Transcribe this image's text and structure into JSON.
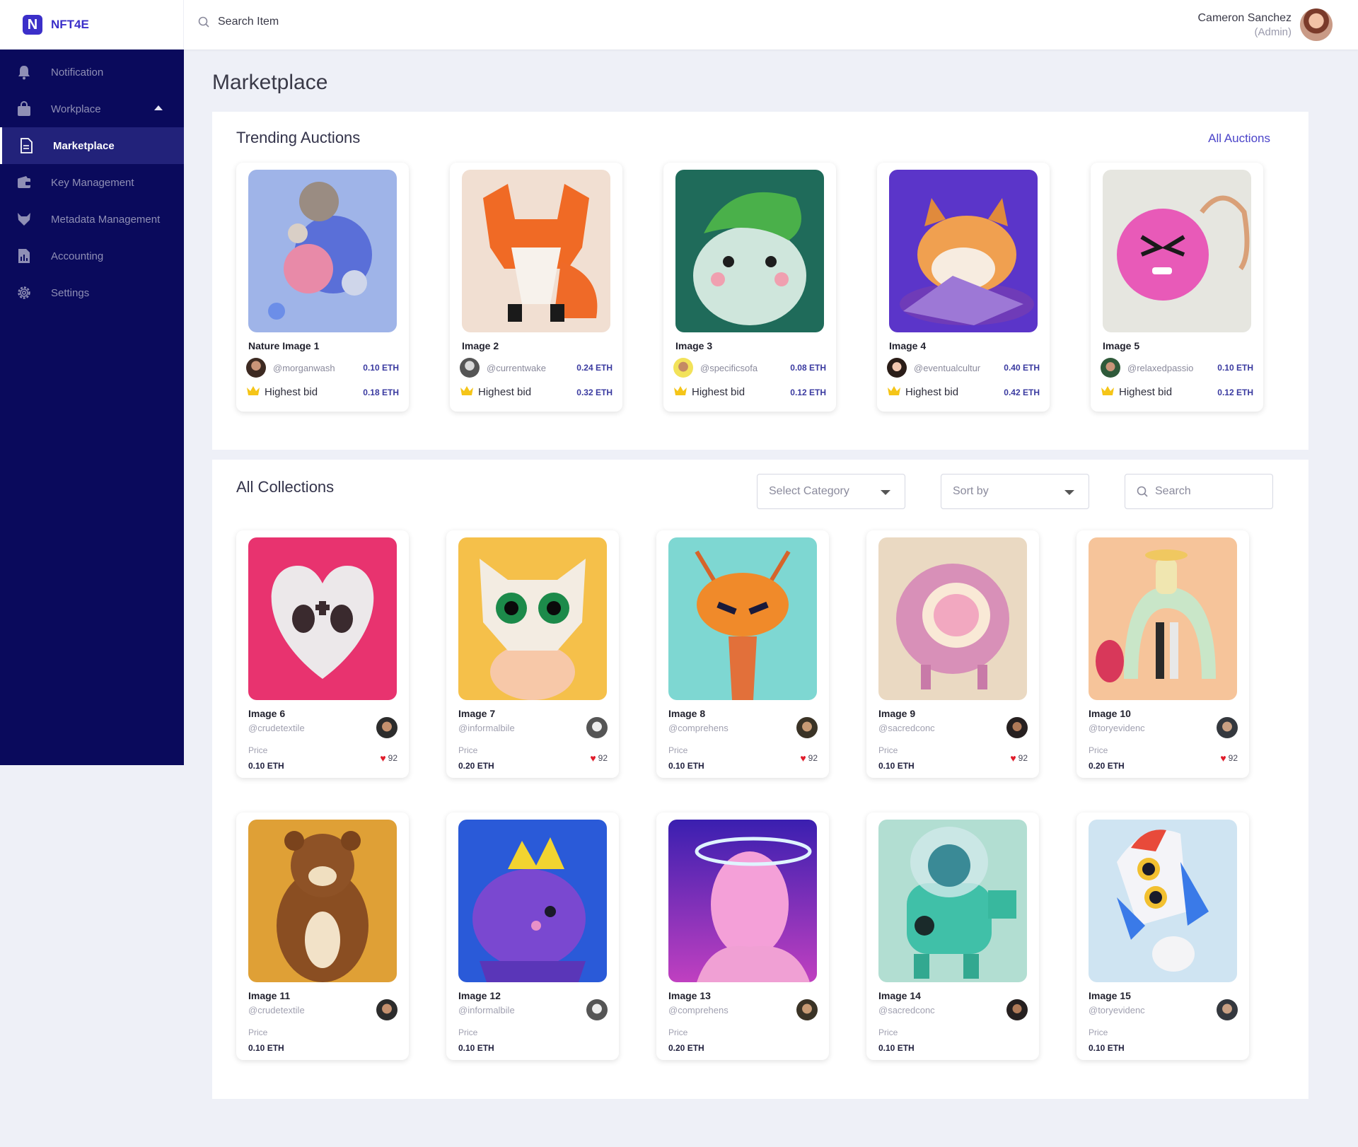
{
  "brand": {
    "logo_letter": "N",
    "name": "NFT4E"
  },
  "top_search": {
    "placeholder": "Search Item"
  },
  "user": {
    "name": "Cameron Sanchez",
    "role": "(Admin)"
  },
  "sidebar": {
    "items": [
      {
        "label": "Notification",
        "icon": "bell-icon"
      },
      {
        "label": "Workplace",
        "icon": "bag-icon"
      },
      {
        "label": "Marketplace",
        "icon": "document-icon",
        "active": true
      },
      {
        "label": "Key Management",
        "icon": "wallet-icon"
      },
      {
        "label": "Metadata Management",
        "icon": "fox-icon"
      },
      {
        "label": "Accounting",
        "icon": "report-icon"
      },
      {
        "label": "Settings",
        "icon": "gear-icon"
      }
    ]
  },
  "page_title": "Marketplace",
  "trending": {
    "title": "Trending Auctions",
    "link": "All Auctions",
    "bid_label": "Highest bid",
    "cards": [
      {
        "name": "Nature Image 1",
        "handle": "@morganwash",
        "price": "0.10 ETH",
        "bid": "0.18 ETH"
      },
      {
        "name": "Image 2",
        "handle": "@currentwake",
        "price": "0.24 ETH",
        "bid": "0.32 ETH"
      },
      {
        "name": "Image 3",
        "handle": "@specificsofa",
        "price": "0.08 ETH",
        "bid": "0.12 ETH"
      },
      {
        "name": "Image 4",
        "handle": "@eventualcultur",
        "price": "0.40 ETH",
        "bid": "0.42 ETH"
      },
      {
        "name": "Image 5",
        "handle": "@relaxedpassio",
        "price": "0.10 ETH",
        "bid": "0.12 ETH"
      }
    ]
  },
  "collections": {
    "title": "All Collections",
    "category_placeholder": "Select Category",
    "sort_placeholder": "Sort by",
    "search_placeholder": "Search",
    "price_label": "Price",
    "cards": [
      {
        "name": "Image 6",
        "handle": "@crudetextile",
        "price": "0.10 ETH",
        "likes": "92"
      },
      {
        "name": "Image 7",
        "handle": "@informalbile",
        "price": "0.20 ETH",
        "likes": "92"
      },
      {
        "name": "Image 8",
        "handle": "@comprehens",
        "price": "0.10 ETH",
        "likes": "92"
      },
      {
        "name": "Image 9",
        "handle": "@sacredconc",
        "price": "0.10 ETH",
        "likes": "92"
      },
      {
        "name": "Image 10",
        "handle": "@toryevidenc",
        "price": "0.20 ETH",
        "likes": "92"
      },
      {
        "name": "Image 11",
        "handle": "@crudetextile",
        "price": "0.10 ETH"
      },
      {
        "name": "Image 12",
        "handle": "@informalbile",
        "price": "0.10 ETH"
      },
      {
        "name": "Image 13",
        "handle": "@comprehens",
        "price": "0.20 ETH"
      },
      {
        "name": "Image 14",
        "handle": "@sacredconc",
        "price": "0.10 ETH"
      },
      {
        "name": "Image 15",
        "handle": "@toryevidenc",
        "price": "0.10 ETH"
      }
    ]
  },
  "colors": {
    "sidebar_bg": "#0a0a5c",
    "accent": "#4b44c9",
    "heart": "#e01b2a",
    "crown": "#f5c518"
  }
}
